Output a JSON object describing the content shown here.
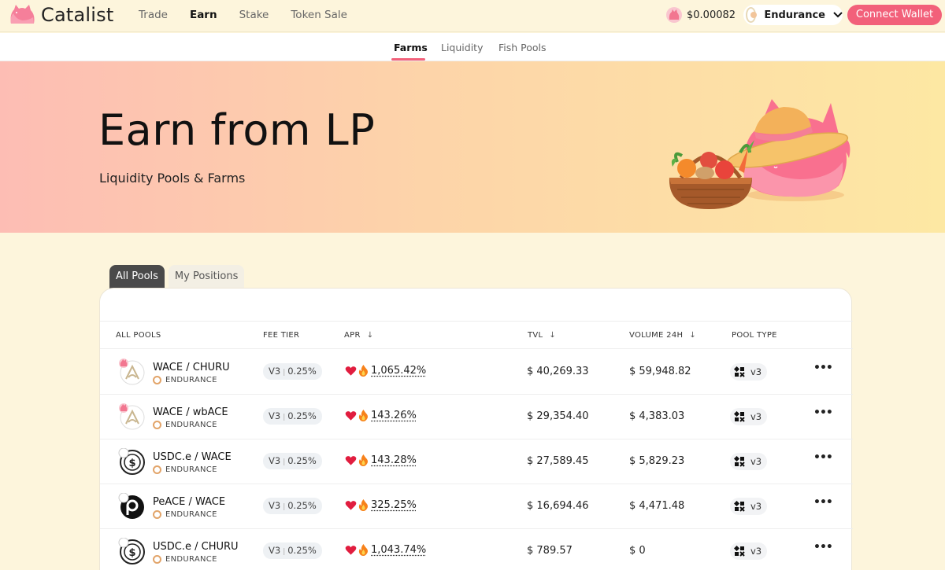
{
  "app": {
    "logo_text": "Catalist"
  },
  "nav": {
    "items": [
      "Trade",
      "Earn",
      "Stake",
      "Token Sale"
    ],
    "active": "Earn"
  },
  "header": {
    "price": "$0.00082",
    "network": "Endurance",
    "connect_label": "Connect Wallet"
  },
  "subnav": {
    "tabs": [
      "Farms",
      "Liquidity",
      "Fish Pools"
    ],
    "active": "Farms"
  },
  "hero": {
    "title": "Earn from LP",
    "subtitle": "Liquidity Pools & Farms"
  },
  "pool_tabs": {
    "all": "All Pools",
    "positions": "My Positions"
  },
  "table": {
    "headers": {
      "pools": "ALL POOLS",
      "fee": "FEE TIER",
      "apr": "APR",
      "tvl": "TVL",
      "volume": "VOLUME 24H",
      "type": "POOL TYPE"
    },
    "rows": [
      {
        "pair": "WACE / CHURU",
        "chain": "ENDURANCE",
        "version": "V3",
        "fee": "0.25%",
        "apr": "1,065.42%",
        "tvl": "$ 40,269.33",
        "volume": "$ 59,948.82",
        "type": "v3",
        "logo": "wace"
      },
      {
        "pair": "WACE / wbACE",
        "chain": "ENDURANCE",
        "version": "V3",
        "fee": "0.25%",
        "apr": "143.26%",
        "tvl": "$ 29,354.40",
        "volume": "$ 4,383.03",
        "type": "v3",
        "logo": "wace"
      },
      {
        "pair": "USDC.e / WACE",
        "chain": "ENDURANCE",
        "version": "V3",
        "fee": "0.25%",
        "apr": "143.28%",
        "tvl": "$ 27,589.45",
        "volume": "$ 5,829.23",
        "type": "v3",
        "logo": "usdc"
      },
      {
        "pair": "PeACE / WACE",
        "chain": "ENDURANCE",
        "version": "V3",
        "fee": "0.25%",
        "apr": "325.25%",
        "tvl": "$ 16,694.46",
        "volume": "$ 4,471.48",
        "type": "v3",
        "logo": "peace"
      },
      {
        "pair": "USDC.e / CHURU",
        "chain": "ENDURANCE",
        "version": "V3",
        "fee": "0.25%",
        "apr": "1,043.74%",
        "tvl": "$ 789.57",
        "volume": "$ 0",
        "type": "v3",
        "logo": "usdc"
      }
    ]
  },
  "colors": {
    "accent": "#f2607a",
    "background": "#fdf5dc",
    "hero_start": "#fdbdb4",
    "hero_end": "#fde8a3"
  }
}
